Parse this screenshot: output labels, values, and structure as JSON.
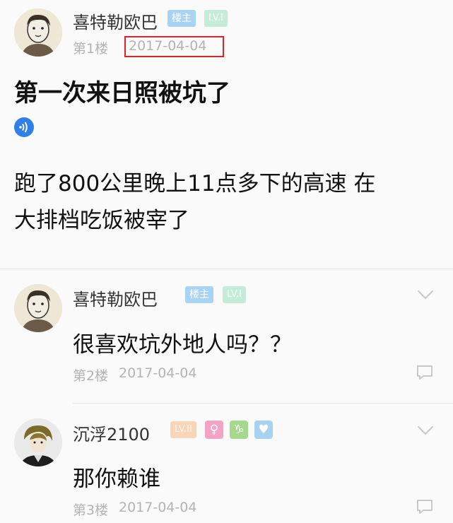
{
  "post": {
    "author": "喜特勒欧巴",
    "owner_badge": "楼主",
    "level_badge": "LV.I",
    "floor": "第1楼",
    "date": "2017-04-04",
    "title": "第一次来日照被坑了",
    "voice_icon": "voice-wave-icon",
    "body_line1": "跑了800公里晚上11点多下的高速 在",
    "body_line2": "大排档吃饭被宰了"
  },
  "replies": [
    {
      "author": "喜特勒欧巴",
      "owner_badge": "楼主",
      "level_badge": "LV.I",
      "text": "很喜欢坑外地人吗？？",
      "floor": "第2楼",
      "date": "2017-04-04"
    },
    {
      "author": "沉浮2100",
      "level_badge": "LV.II",
      "gender_icon": "female-icon",
      "zodiac_icon": "capricorn-icon",
      "extra_badge_icon": "couple-badge-icon",
      "text": "那你赖谁",
      "floor": "第3楼",
      "date": "2017-04-04"
    }
  ],
  "colors": {
    "highlight_box": "#e0202a",
    "owner_badge": "#a9d3f2",
    "level_badge": "#c5ebd9",
    "meta_text": "#b3b3b3",
    "voice_icon": "#2f7fe6"
  }
}
